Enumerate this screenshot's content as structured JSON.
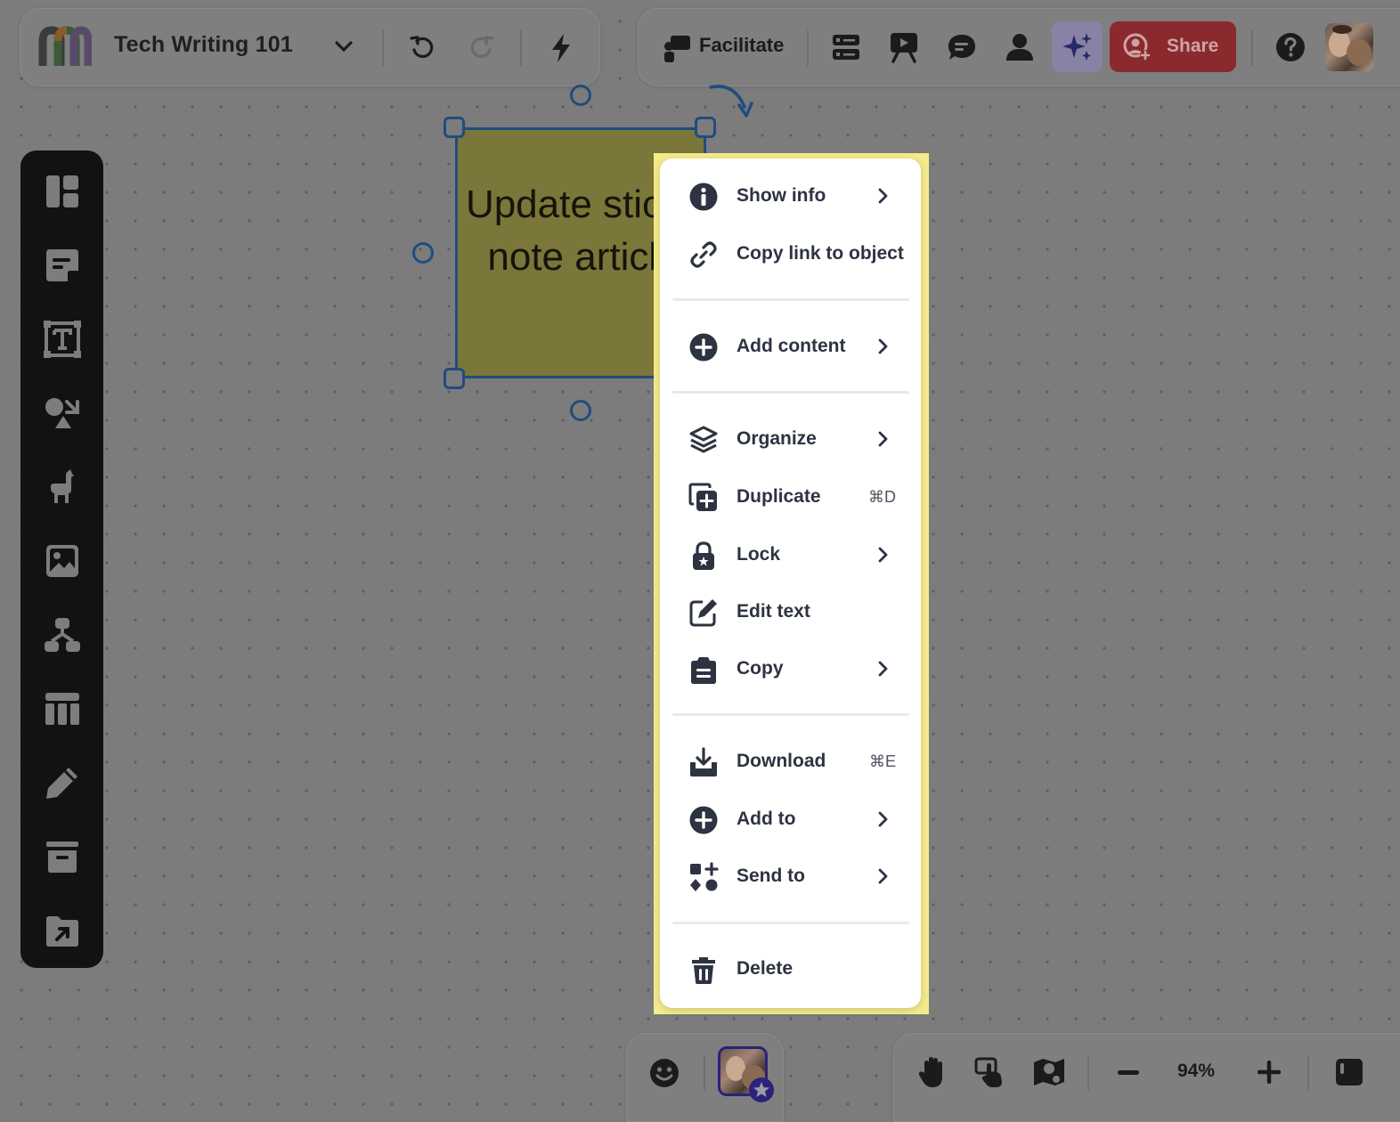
{
  "board": {
    "title": "Tech Writing 101"
  },
  "toolbar": {
    "facilitate_label": "Facilitate",
    "share_label": "Share"
  },
  "sticky_note": {
    "text": "Update sticky note article"
  },
  "context_menu": {
    "items": [
      {
        "label": "Show info",
        "icon": "info-icon",
        "submenu": true
      },
      {
        "label": "Copy link to object",
        "icon": "link-icon",
        "submenu": false
      },
      {
        "label": "Add content",
        "icon": "plus-circle-icon",
        "submenu": true
      },
      {
        "label": "Organize",
        "icon": "layers-icon",
        "submenu": true
      },
      {
        "label": "Duplicate",
        "icon": "duplicate-icon",
        "submenu": false,
        "shortcut": "⌘D"
      },
      {
        "label": "Lock",
        "icon": "lock-icon",
        "submenu": true
      },
      {
        "label": "Edit text",
        "icon": "edit-icon",
        "submenu": false
      },
      {
        "label": "Copy",
        "icon": "clipboard-icon",
        "submenu": true
      },
      {
        "label": "Download",
        "icon": "download-icon",
        "submenu": false,
        "shortcut": "⌘E"
      },
      {
        "label": "Add to",
        "icon": "plus-circle-icon",
        "submenu": true
      },
      {
        "label": "Send to",
        "icon": "shapes-icon",
        "submenu": true
      },
      {
        "label": "Delete",
        "icon": "trash-icon",
        "submenu": false
      }
    ]
  },
  "zoom": {
    "level": "94%"
  },
  "colors": {
    "overlay": "#7c7c7c",
    "sidebar": "#111214",
    "selection": "#214c7d",
    "share": "#8a2a2e",
    "menu_text": "#2e3342"
  }
}
